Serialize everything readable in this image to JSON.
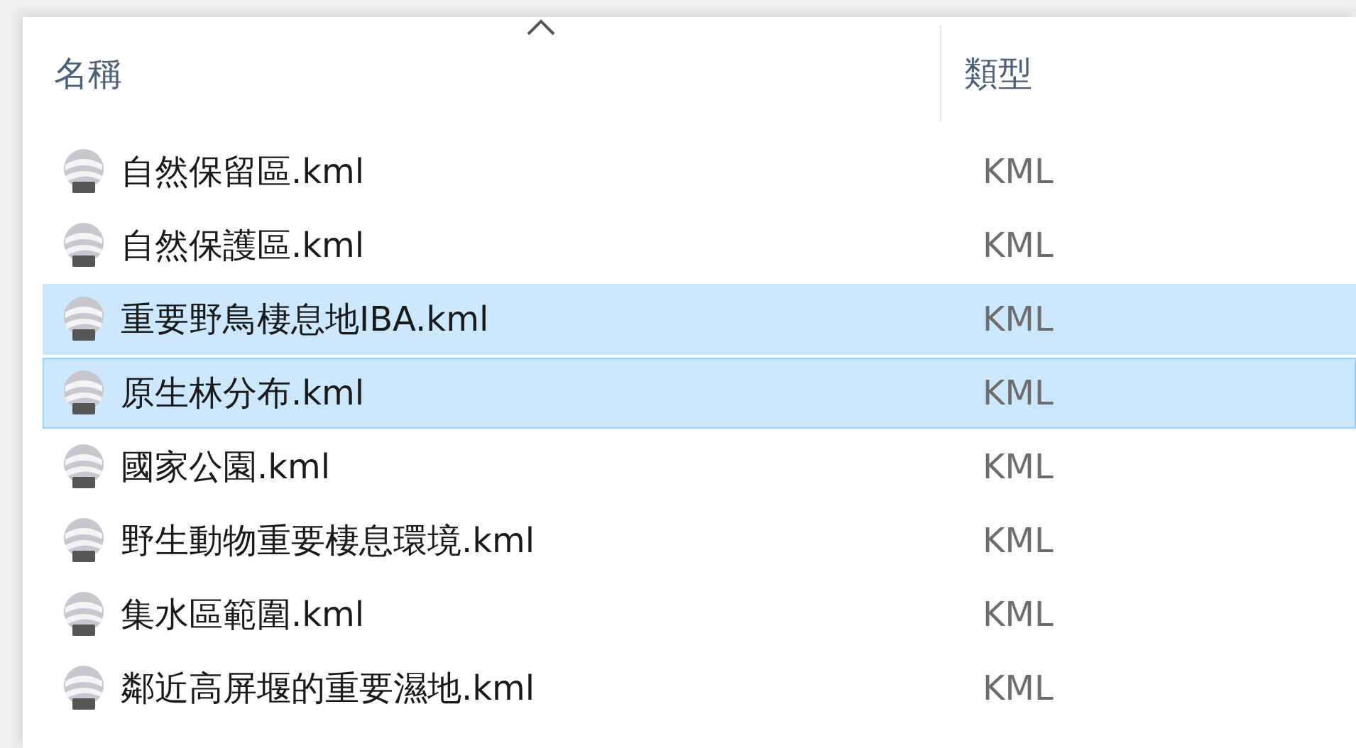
{
  "columns": [
    {
      "label": "名稱",
      "sorted": true
    },
    {
      "label": "類型"
    }
  ],
  "files": [
    {
      "name": "自然保留區.kml",
      "type": "KML",
      "selected": false,
      "focused": false
    },
    {
      "name": "自然保護區.kml",
      "type": "KML",
      "selected": false,
      "focused": false
    },
    {
      "name": "重要野鳥棲息地IBA.kml",
      "type": "KML",
      "selected": true,
      "focused": false
    },
    {
      "name": "原生林分布.kml",
      "type": "KML",
      "selected": true,
      "focused": true
    },
    {
      "name": "國家公園.kml",
      "type": "KML",
      "selected": false,
      "focused": false
    },
    {
      "name": "野生動物重要棲息環境.kml",
      "type": "KML",
      "selected": false,
      "focused": false
    },
    {
      "name": "集水區範圍.kml",
      "type": "KML",
      "selected": false,
      "focused": false
    },
    {
      "name": "鄰近高屏堰的重要濕地.kml",
      "type": "KML",
      "selected": false,
      "focused": false
    }
  ]
}
